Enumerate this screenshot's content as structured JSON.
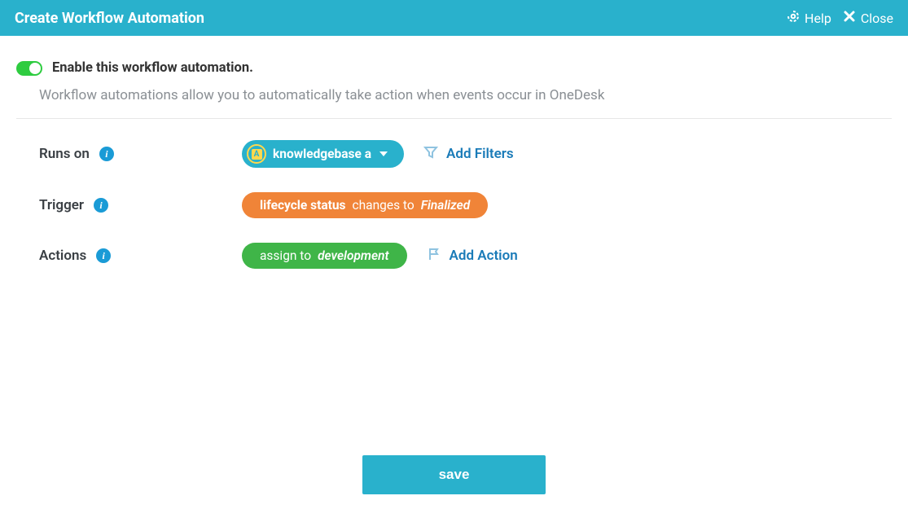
{
  "header": {
    "title": "Create Workflow Automation",
    "help": "Help",
    "close": "Close"
  },
  "enable": {
    "label": "Enable this workflow automation.",
    "toggled": true
  },
  "description": "Workflow automations allow you to automatically take action when events occur in OneDesk",
  "rows": {
    "runsOn": {
      "label": "Runs on",
      "pill": {
        "icon": "A",
        "text": "knowledgebase a"
      },
      "addLink": "Add Filters"
    },
    "trigger": {
      "label": "Trigger",
      "pill": {
        "field": "lifecycle status",
        "verb": "changes to",
        "value": "Finalized"
      }
    },
    "actions": {
      "label": "Actions",
      "pill": {
        "verb": "assign to",
        "value": "development"
      },
      "addLink": "Add Action"
    }
  },
  "save": "save",
  "colors": {
    "brand": "#29b1cc",
    "orange": "#f08438",
    "green": "#3fb548",
    "info": "#1a9bd6"
  }
}
